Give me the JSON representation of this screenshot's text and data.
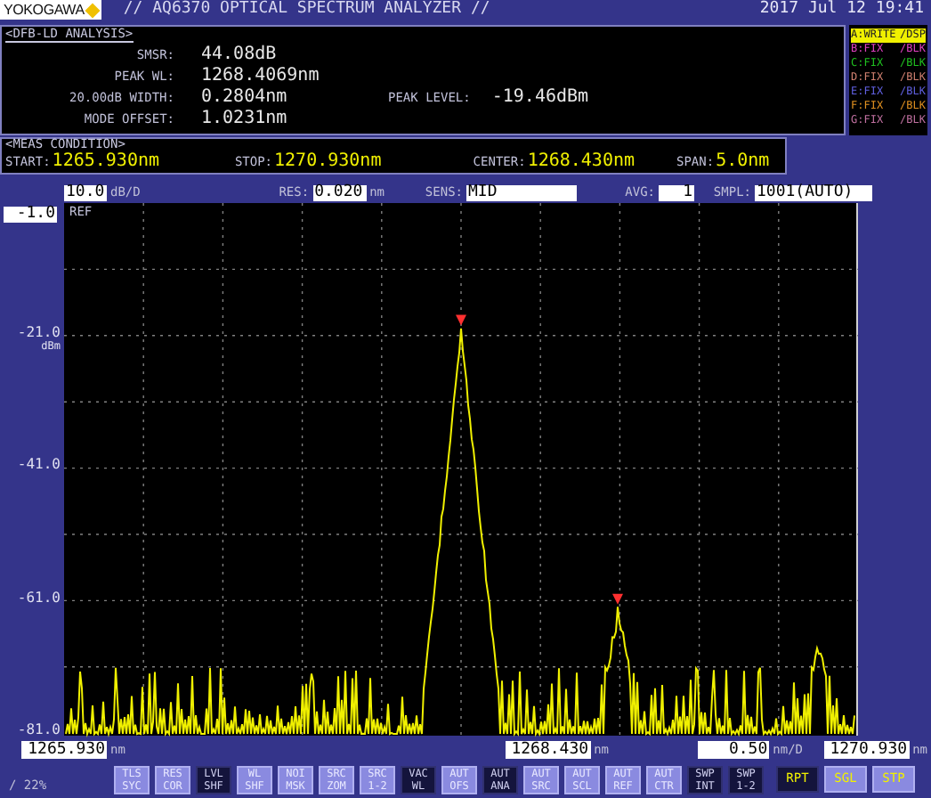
{
  "header": {
    "brand": "YOKOGAWA",
    "title": "// AQ6370 OPTICAL SPECTRUM ANALYZER //",
    "datetime": "2017 Jul 12 19:41"
  },
  "analysis": {
    "title": "<DFB-LD ANALYSIS>",
    "rows": [
      {
        "label": "SMSR:",
        "value": "44.08dB"
      },
      {
        "label": "PEAK WL:",
        "value": "1268.4069nm"
      },
      {
        "label": "20.00dB WIDTH:",
        "value": "0.2804nm"
      },
      {
        "label": "MODE OFFSET:",
        "value": "1.0231nm"
      }
    ],
    "peak_level": {
      "label": "PEAK LEVEL:",
      "value": "-19.46dBm"
    }
  },
  "traces": [
    {
      "name": "A:WRITE",
      "mode": "/DSP",
      "selected": true,
      "color": "#f0f000"
    },
    {
      "name": "B:FIX",
      "mode": "/BLK",
      "selected": false,
      "color": "#e040c0"
    },
    {
      "name": "C:FIX",
      "mode": "/BLK",
      "selected": false,
      "color": "#20c020"
    },
    {
      "name": "D:FIX",
      "mode": "/BLK",
      "selected": false,
      "color": "#d08070"
    },
    {
      "name": "E:FIX",
      "mode": "/BLK",
      "selected": false,
      "color": "#6060e0"
    },
    {
      "name": "F:FIX",
      "mode": "/BLK",
      "selected": false,
      "color": "#e09020"
    },
    {
      "name": "G:FIX",
      "mode": "/BLK",
      "selected": false,
      "color": "#c070a0"
    }
  ],
  "meas_condition": {
    "title": "<MEAS CONDITION>",
    "items": [
      {
        "label": "START:",
        "value": "1265.930nm"
      },
      {
        "label": "STOP:",
        "value": "1270.930nm"
      },
      {
        "label": "CENTER:",
        "value": "1268.430nm"
      },
      {
        "label": "SPAN:",
        "value": "5.0nm"
      }
    ]
  },
  "settings": [
    {
      "value": "10.0",
      "unit": "dB/D"
    },
    {
      "label": "RES:",
      "value": "0.020",
      "unit": "nm"
    },
    {
      "label": "SENS:",
      "value": "MID"
    },
    {
      "label": "AVG:",
      "value": "1"
    },
    {
      "label": "SMPL:",
      "value": "1001(AUTO)"
    }
  ],
  "ref": {
    "value": "-1.0",
    "label": "REF"
  },
  "y_labels": [
    {
      "value": "-21.0",
      "unit": "dBm"
    },
    {
      "value": "-41.0"
    },
    {
      "value": "-61.0"
    },
    {
      "value": "-81.0"
    }
  ],
  "x_labels": [
    {
      "value": "1265.930",
      "unit": "nm"
    },
    {
      "value": "1268.430",
      "unit": "nm"
    },
    {
      "value": "0.50",
      "unit": "nm/D"
    },
    {
      "value": "1270.930",
      "unit": "nm"
    }
  ],
  "progress": "/ 22%",
  "buttons": [
    {
      "kind": "function",
      "top": "TLS",
      "bottom": "SYC",
      "active": false
    },
    {
      "kind": "function",
      "top": "RES",
      "bottom": "COR",
      "active": false
    },
    {
      "kind": "function",
      "top": "LVL",
      "bottom": "SHF",
      "active": true
    },
    {
      "kind": "function",
      "top": "WL",
      "bottom": "SHF",
      "active": false
    },
    {
      "kind": "function",
      "top": "NOI",
      "bottom": "MSK",
      "active": false
    },
    {
      "kind": "function",
      "top": "SRC",
      "bottom": "ZOM",
      "active": false
    },
    {
      "kind": "function",
      "top": "SRC",
      "bottom": "1-2",
      "active": false
    },
    {
      "kind": "function",
      "top": "VAC",
      "bottom": "WL",
      "active": true
    },
    {
      "kind": "function",
      "top": "AUT",
      "bottom": "OFS",
      "active": false
    },
    {
      "kind": "function",
      "top": "AUT",
      "bottom": "ANA",
      "active": true
    },
    {
      "kind": "function",
      "top": "AUT",
      "bottom": "SRC",
      "active": false
    },
    {
      "kind": "function",
      "top": "AUT",
      "bottom": "SCL",
      "active": false
    },
    {
      "kind": "function",
      "top": "AUT",
      "bottom": "REF",
      "active": false
    },
    {
      "kind": "function",
      "top": "AUT",
      "bottom": "CTR",
      "active": false
    },
    {
      "kind": "function",
      "top": "SWP",
      "bottom": "INT",
      "active": true
    },
    {
      "kind": "function",
      "top": "SWP",
      "bottom": "1-2",
      "active": true
    },
    {
      "kind": "sweep",
      "top": "RPT",
      "active": true
    },
    {
      "kind": "sweep",
      "top": "SGL",
      "active": false
    },
    {
      "kind": "sweep",
      "top": "STP",
      "active": false
    }
  ]
}
